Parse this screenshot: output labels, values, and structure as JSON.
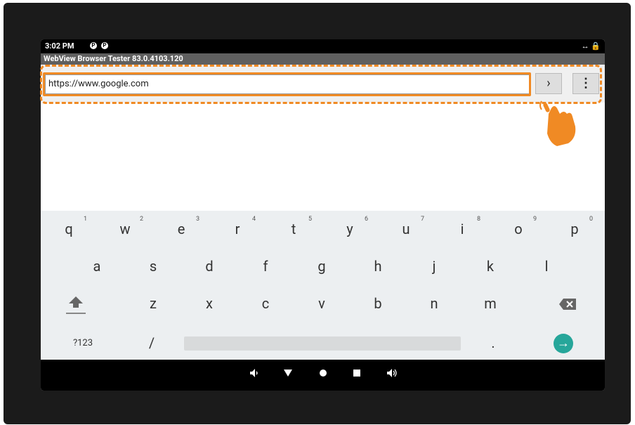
{
  "statusbar": {
    "time": "3:02 PM",
    "icon1": "P",
    "icon2": "P",
    "right": "↔ 🔒"
  },
  "app": {
    "title": "WebView Browser Tester 83.0.4103.120"
  },
  "url": {
    "value": "https://www.google.com",
    "go_label": "›",
    "menu_label": "⋮"
  },
  "keyboard": {
    "row1": [
      {
        "k": "q",
        "h": "1"
      },
      {
        "k": "w",
        "h": "2"
      },
      {
        "k": "e",
        "h": "3"
      },
      {
        "k": "r",
        "h": "4"
      },
      {
        "k": "t",
        "h": "5"
      },
      {
        "k": "y",
        "h": "6"
      },
      {
        "k": "u",
        "h": "7"
      },
      {
        "k": "i",
        "h": "8"
      },
      {
        "k": "o",
        "h": "9"
      },
      {
        "k": "p",
        "h": "0"
      }
    ],
    "row2": [
      "a",
      "s",
      "d",
      "f",
      "g",
      "h",
      "j",
      "k",
      "l"
    ],
    "row3": [
      "z",
      "x",
      "c",
      "v",
      "b",
      "n",
      "m"
    ],
    "symbols_label": "?123",
    "slash_label": "/",
    "period_label": ".",
    "shift_icon": "shift-icon",
    "backspace_icon": "backspace-icon",
    "enter_icon": "enter-arrow-icon"
  },
  "nav": {
    "volume_down": "volume-down-icon",
    "back": "back-icon",
    "home": "home-icon",
    "recents": "recents-icon",
    "volume_up": "volume-up-icon"
  },
  "colors": {
    "accent": "#f08a24",
    "enter": "#26a69a"
  }
}
